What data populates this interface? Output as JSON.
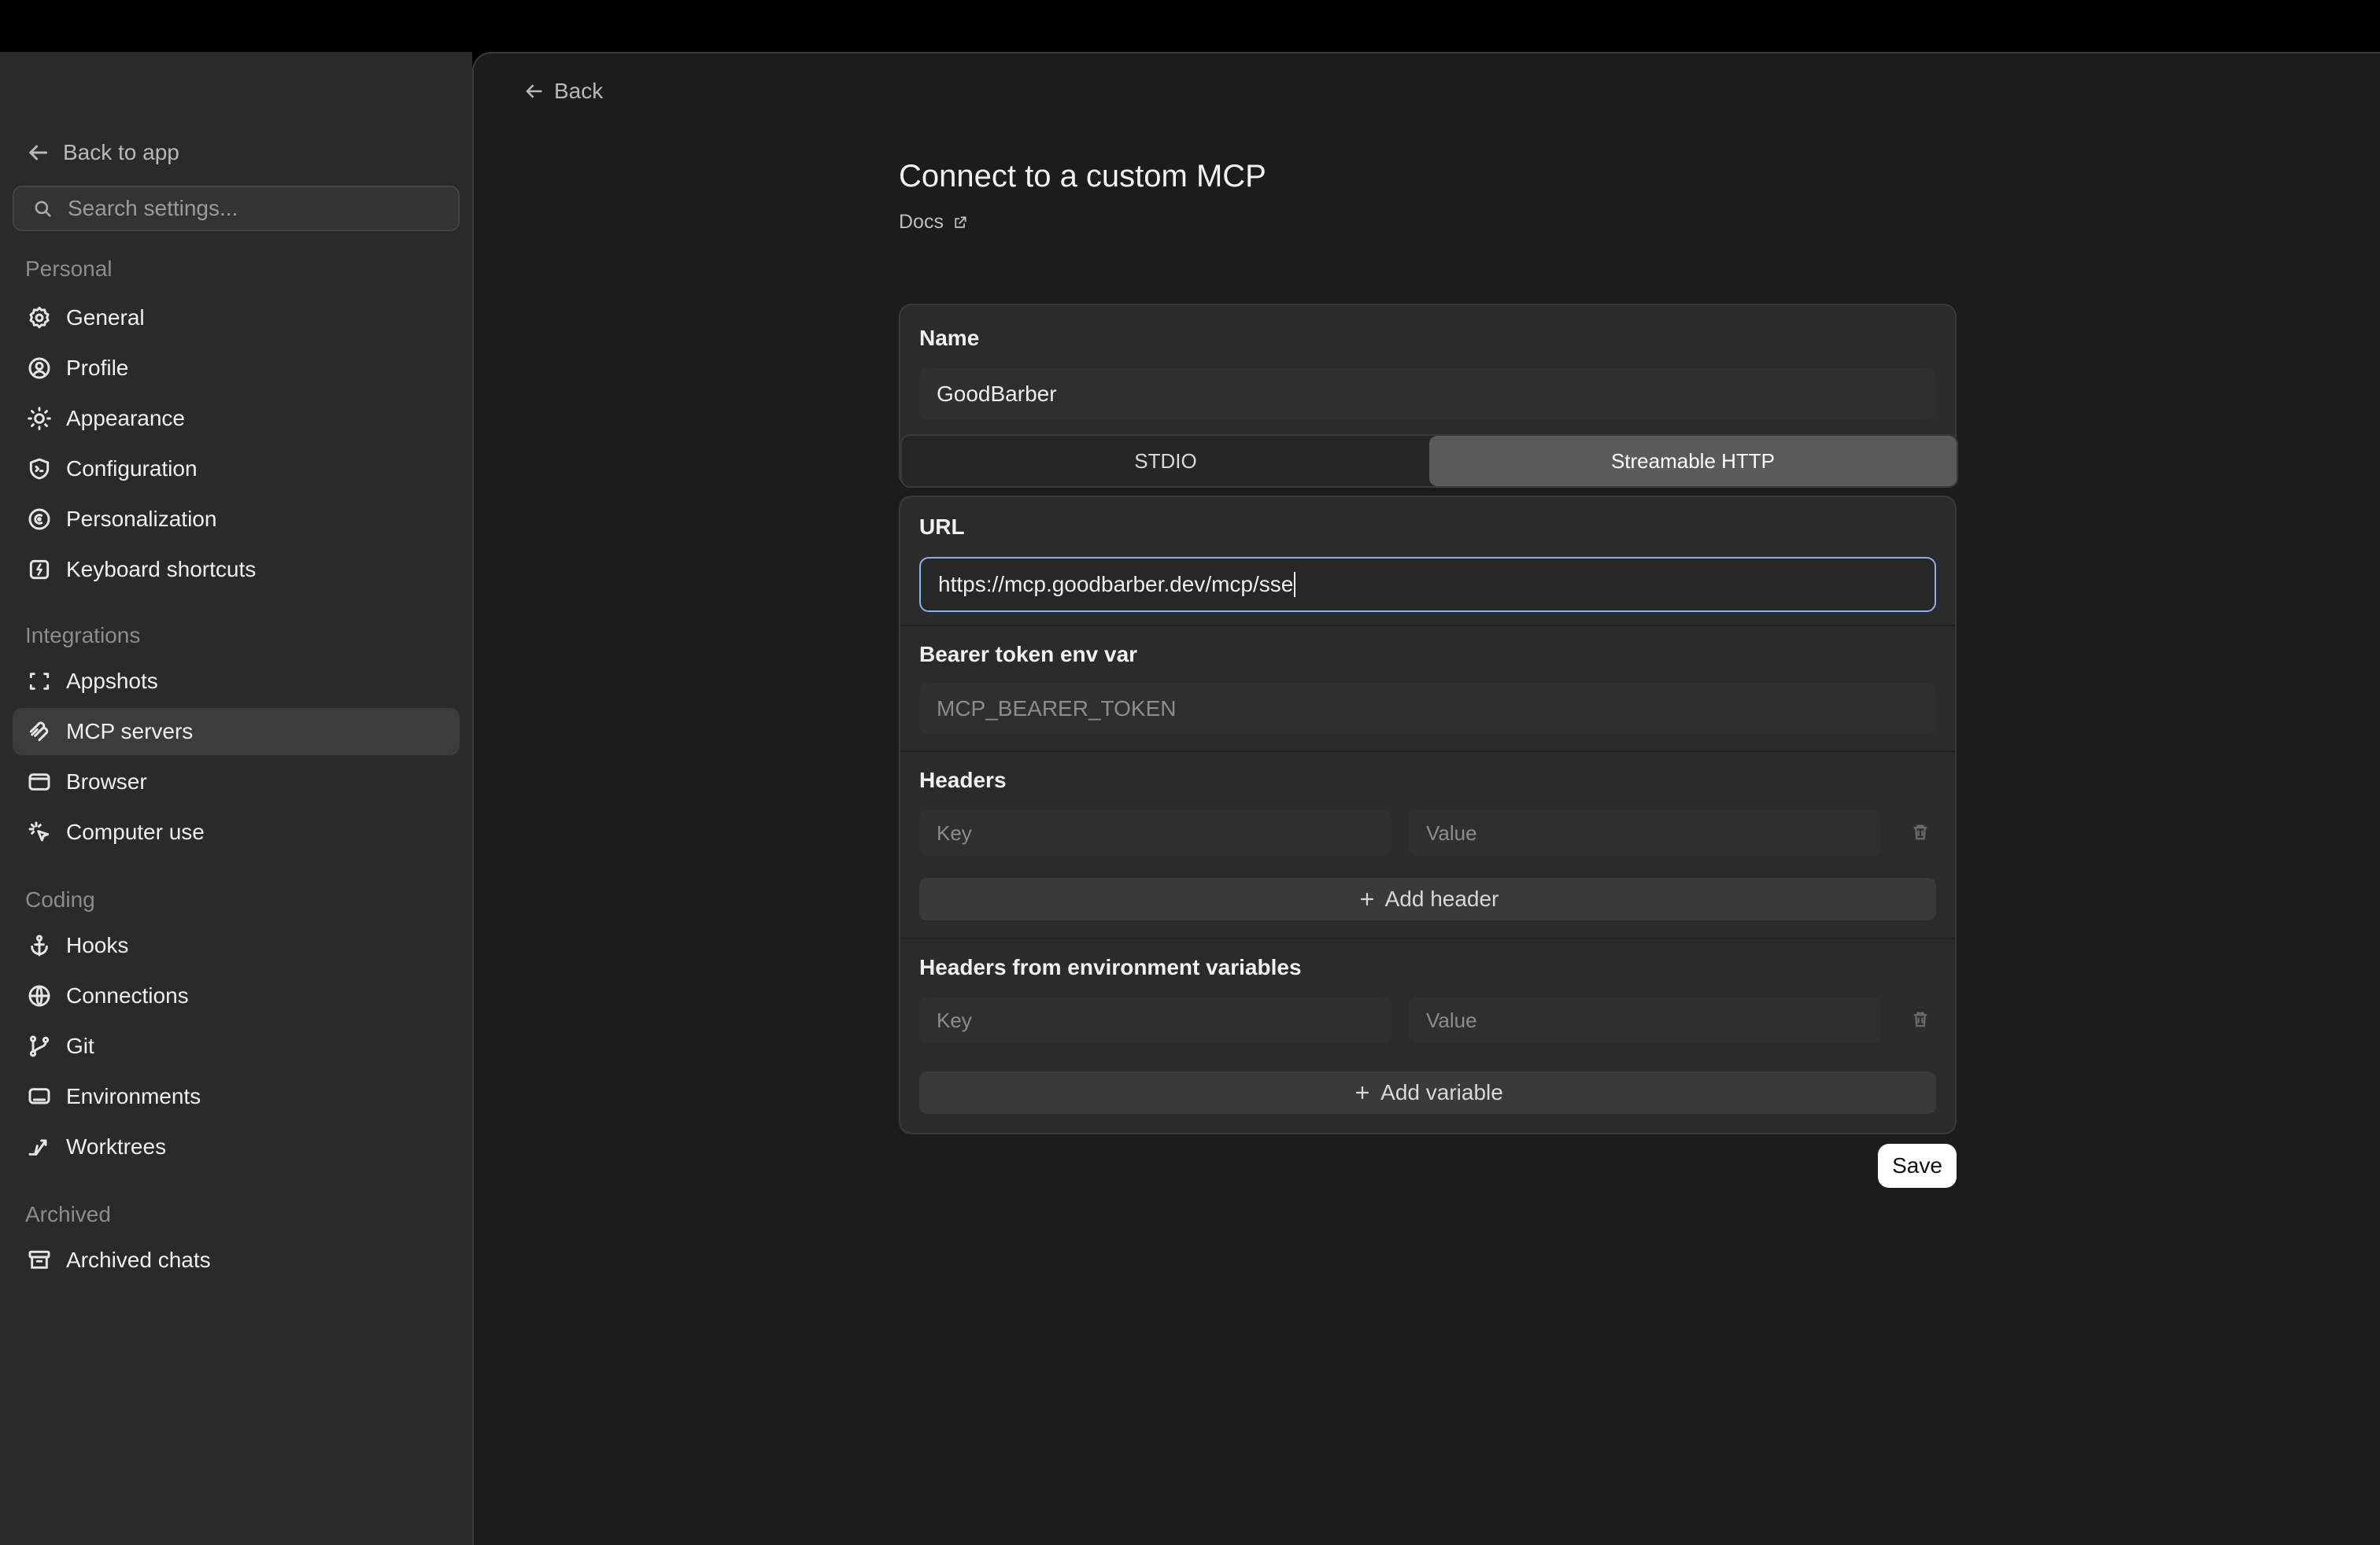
{
  "sidebar": {
    "back_to_app": "Back to app",
    "search_placeholder": "Search settings...",
    "sections": [
      {
        "label": "Personal",
        "items": [
          {
            "label": "General",
            "icon": "gear-icon"
          },
          {
            "label": "Profile",
            "icon": "user-circle-icon"
          },
          {
            "label": "Appearance",
            "icon": "sun-icon"
          },
          {
            "label": "Configuration",
            "icon": "shield-config-icon"
          },
          {
            "label": "Personalization",
            "icon": "personalization-icon"
          },
          {
            "label": "Keyboard shortcuts",
            "icon": "keyboard-icon"
          }
        ]
      },
      {
        "label": "Integrations",
        "items": [
          {
            "label": "Appshots",
            "icon": "capture-frame-icon"
          },
          {
            "label": "MCP servers",
            "icon": "mcp-icon"
          },
          {
            "label": "Browser",
            "icon": "browser-window-icon"
          },
          {
            "label": "Computer use",
            "icon": "cursor-click-icon"
          }
        ]
      },
      {
        "label": "Coding",
        "items": [
          {
            "label": "Hooks",
            "icon": "anchor-icon"
          },
          {
            "label": "Connections",
            "icon": "globe-icon"
          },
          {
            "label": "Git",
            "icon": "git-branch-icon"
          },
          {
            "label": "Environments",
            "icon": "monitor-icon"
          },
          {
            "label": "Worktrees",
            "icon": "worktree-icon"
          }
        ]
      },
      {
        "label": "Archived",
        "items": [
          {
            "label": "Archived chats",
            "icon": "archive-icon"
          }
        ]
      }
    ],
    "active_item": "MCP servers"
  },
  "main": {
    "back_label": "Back",
    "title": "Connect to a custom MCP",
    "docs_label": "Docs",
    "name_label": "Name",
    "name_value": "GoodBarber",
    "transport_options": [
      "STDIO",
      "Streamable HTTP"
    ],
    "transport_selected": "Streamable HTTP",
    "url_label": "URL",
    "url_value": "https://mcp.goodbarber.dev/mcp/sse",
    "bearer_label": "Bearer token env var",
    "bearer_placeholder": "MCP_BEARER_TOKEN",
    "headers_label": "Headers",
    "headers_key_placeholder": "Key",
    "headers_value_placeholder": "Value",
    "add_header_label": "Add header",
    "env_headers_label": "Headers from environment variables",
    "env_key_placeholder": "Key",
    "env_value_placeholder": "Value",
    "add_variable_label": "Add variable",
    "save_label": "Save"
  }
}
